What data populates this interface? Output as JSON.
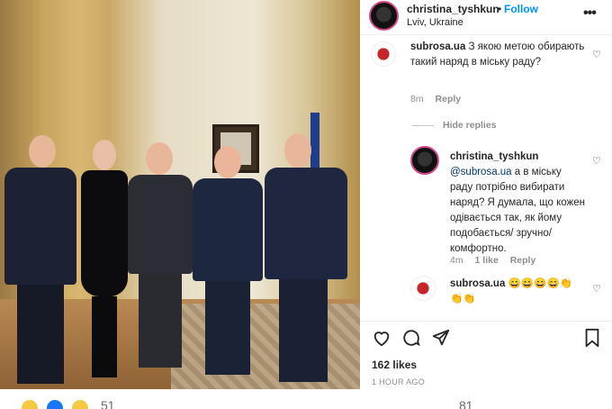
{
  "post": {
    "username": "christina_tyshkun",
    "separator": "•",
    "follow": "Follow",
    "location": "Lviv, Ukraine",
    "more_icon": "more-horizontal-icon"
  },
  "comments": [
    {
      "username": "subrosa.ua",
      "text": "З якою метою обирають такий наряд в міську раду?",
      "age": "8m",
      "reply": "Reply"
    }
  ],
  "hide_replies": "Hide replies",
  "reply_comment": {
    "username": "christina_tyshkun",
    "mention": "@subrosa.ua",
    "text": "а в міську раду потрібно вибирати наряд? Я думала, що кожен одівається так, як йому подобається/ зручно/комфортно.",
    "age": "4m",
    "likes": "1 like",
    "reply": "Reply"
  },
  "last_comment": {
    "username": "subrosa.ua",
    "emojis": "😄😄😄😄👏 👏👏"
  },
  "likes": "162 likes",
  "time": "1 HOUR AGO",
  "bottom": {
    "count_left": "51",
    "count_right": "81"
  },
  "colors": {
    "link": "#0095f6",
    "muted": "#8e8e8e",
    "text": "#262626"
  }
}
